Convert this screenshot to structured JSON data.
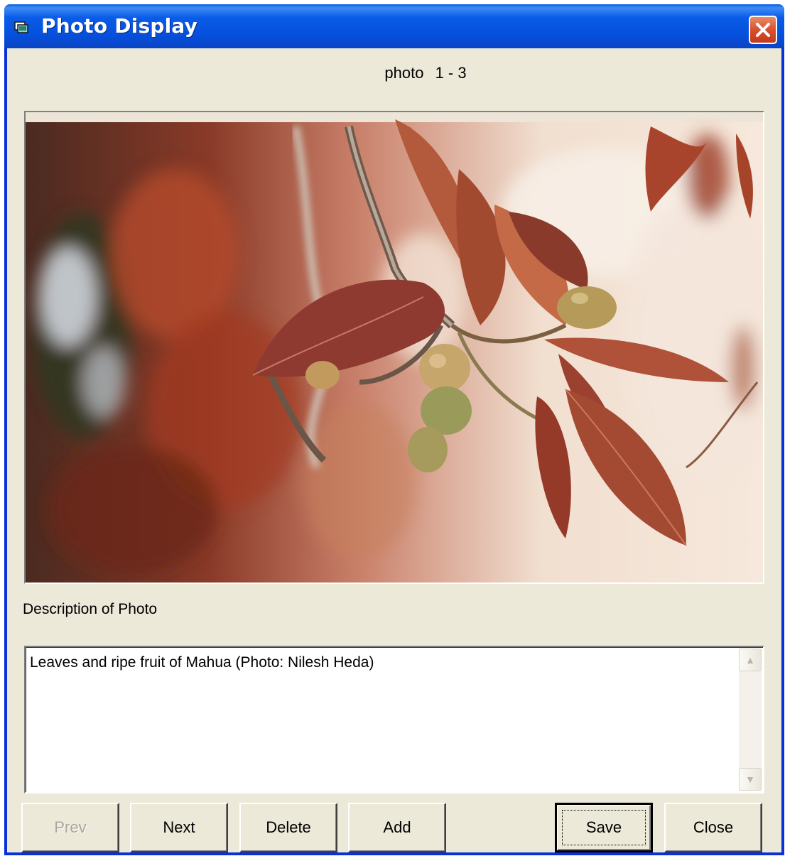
{
  "window": {
    "title": "Photo Display",
    "close_label": "×"
  },
  "counter": {
    "label": "photo",
    "value": "1 - 3"
  },
  "description": {
    "label": "Description of Photo",
    "text": "Leaves and ripe fruit of Mahua (Photo: Nilesh Heda)"
  },
  "buttons": {
    "prev": "Prev",
    "next": "Next",
    "delete": "Delete",
    "add": "Add",
    "save": "Save",
    "close": "Close"
  },
  "scrollbar": {
    "up_icon": "▲",
    "down_icon": "▼"
  },
  "colors": {
    "titlebar": "#0550dc",
    "window_bg": "#ece9d8",
    "close_button": "#d8502e"
  }
}
